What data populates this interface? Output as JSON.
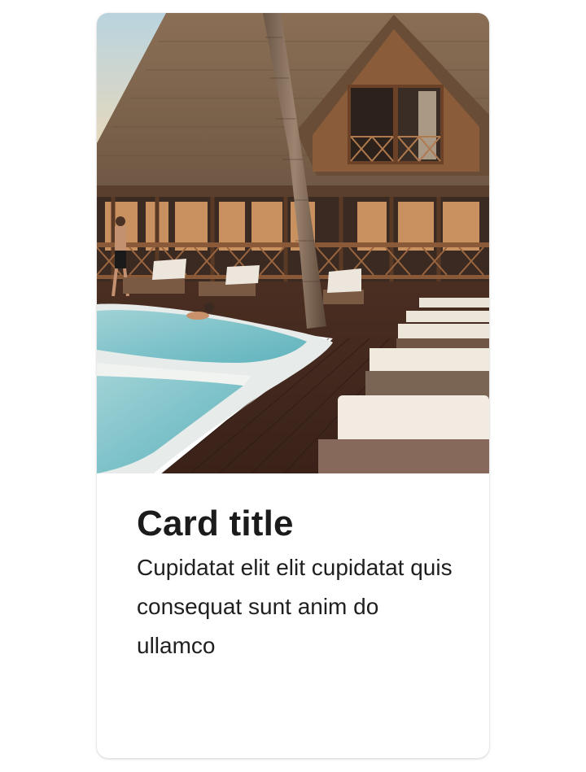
{
  "card": {
    "image_alt": "Resort with swimming pool, wooden deck, sun loungers and palm tree",
    "title": "Card title",
    "text": "Cupidatat elit elit cupidatat quis consequat sunt anim do ullamco"
  },
  "colors": {
    "background": "#ffffff",
    "title": "#1b1b1b",
    "text": "#1f1f1f"
  }
}
